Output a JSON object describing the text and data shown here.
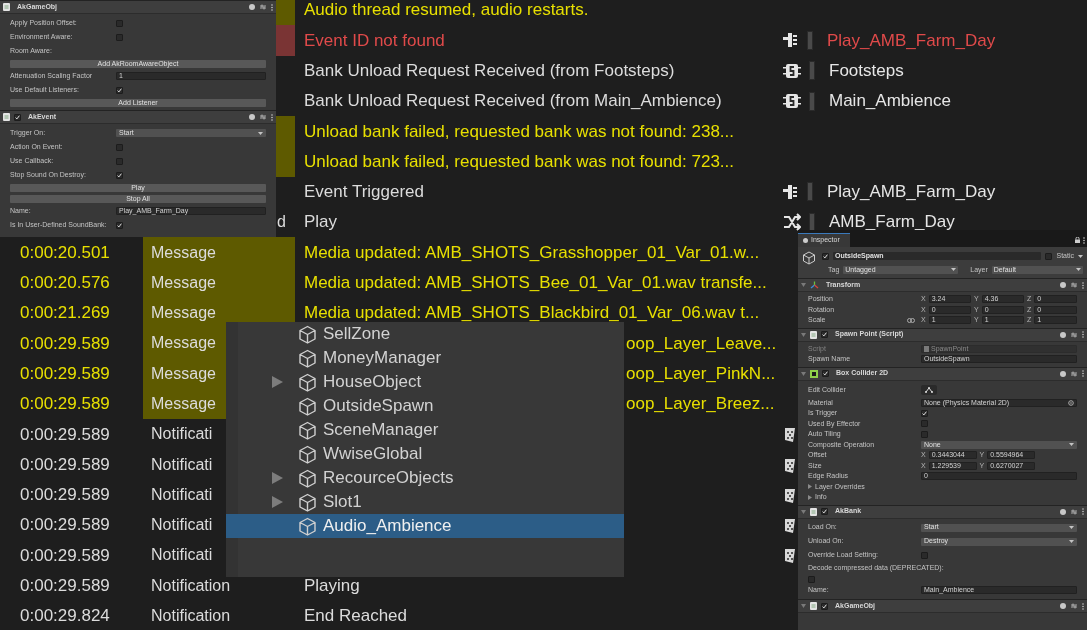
{
  "log": {
    "rows": [
      {
        "kind": "warning",
        "message": "Audio thread resumed, audio restarts."
      },
      {
        "kind": "error",
        "message": "Event ID not found",
        "object": {
          "kind": "event",
          "name": "Play_AMB_Farm_Day"
        }
      },
      {
        "kind": "info",
        "message": "Bank Unload Request Received (from Footsteps)",
        "object": {
          "kind": "bank",
          "name": "Footsteps"
        }
      },
      {
        "kind": "info",
        "message": "Bank Unload Request Received (from Main_Ambience)",
        "object": {
          "kind": "bank",
          "name": "Main_Ambience"
        }
      },
      {
        "kind": "warning",
        "message": "Unload bank failed, requested bank was not found: 238..."
      },
      {
        "kind": "warning",
        "message": "Unload bank failed, requested bank was not found: 723..."
      },
      {
        "kind": "info",
        "message": "Event Triggered",
        "object": {
          "kind": "event",
          "name": "Play_AMB_Farm_Day"
        }
      },
      {
        "kind": "info",
        "type_tail": "d",
        "message": "Play",
        "object": {
          "kind": "switch",
          "name": "AMB_Farm_Day"
        }
      },
      {
        "kind": "warning",
        "time": "0:00:20.501",
        "type": "Message",
        "message": "Media updated: AMB_SHOTS_Grasshopper_01_Var_01.w..."
      },
      {
        "kind": "warning",
        "time": "0:00:20.576",
        "type": "Message",
        "message": "Media updated: AMB_SHOTS_Bee_01_Var_01.wav transfe..."
      },
      {
        "kind": "warning",
        "time": "0:00:21.269",
        "type": "Message",
        "message": "Media updated: AMB_SHOTS_Blackbird_01_Var_06.wav t..."
      },
      {
        "kind": "warning",
        "time": "0:00:29.589",
        "type": "Message",
        "message_tail": "oop_Layer_Leave..."
      },
      {
        "kind": "warning",
        "time": "0:00:29.589",
        "type": "Message",
        "message_tail": "oop_Layer_PinkN..."
      },
      {
        "kind": "warning",
        "time": "0:00:29.589",
        "type": "Message",
        "message_tail": "oop_Layer_Breez..."
      },
      {
        "kind": "info",
        "time": "0:00:29.589",
        "type": "Notificati",
        "object": {
          "kind": "gameobject"
        }
      },
      {
        "kind": "info",
        "time": "0:00:29.589",
        "type": "Notificati",
        "object": {
          "kind": "gameobject"
        }
      },
      {
        "kind": "info",
        "time": "0:00:29.589",
        "type": "Notificati",
        "object": {
          "kind": "gameobject"
        }
      },
      {
        "kind": "info",
        "time": "0:00:29.589",
        "type": "Notificati",
        "object": {
          "kind": "gameobject"
        }
      },
      {
        "kind": "info",
        "time": "0:00:29.589",
        "type": "Notificati",
        "object": {
          "kind": "gameobject"
        }
      },
      {
        "kind": "info",
        "time": "0:00:29.589",
        "type": "Notification",
        "message": "Playing"
      },
      {
        "kind": "info",
        "time": "0:00:29.824",
        "type": "Notification",
        "message": "End Reached"
      }
    ]
  },
  "component_panel": {
    "components": [
      {
        "kind": "wwise",
        "title": "AkGameObj",
        "rows": [
          {
            "kind": "checkbox",
            "label": "Apply Position Offset:",
            "checked": false
          },
          {
            "kind": "checkbox",
            "label": "Environment Aware:",
            "checked": false
          },
          {
            "kind": "label",
            "label": "Room Aware:"
          },
          {
            "kind": "button",
            "label": "Add AkRoomAwareObject"
          },
          {
            "kind": "field",
            "label": "Attenuation Scaling Factor",
            "value": "1"
          },
          {
            "kind": "checkbox",
            "label": "Use Default Listeners:",
            "checked": true
          },
          {
            "kind": "button",
            "label": "Add Listener"
          }
        ]
      },
      {
        "kind": "wwise",
        "title": "AkEvent",
        "enabled": true,
        "rows": [
          {
            "kind": "dropdown",
            "label": "Trigger On:",
            "value": "Start"
          },
          {
            "kind": "checkbox",
            "label": "Action On Event:",
            "checked": false
          },
          {
            "kind": "checkbox",
            "label": "Use Callback:",
            "checked": false
          },
          {
            "kind": "checkbox",
            "label": "Stop Sound On Destroy:",
            "checked": true
          },
          {
            "kind": "button",
            "label": "Play"
          },
          {
            "kind": "button",
            "label": "Stop All"
          },
          {
            "kind": "field",
            "label": "Name:",
            "value": "Play_AMB_Farm_Day"
          },
          {
            "kind": "checkbox",
            "label": "Is In User-Defined SoundBank:",
            "checked": true
          }
        ]
      }
    ]
  },
  "hierarchy": {
    "items": [
      {
        "name": "SellZone",
        "has_children": false,
        "selected": false
      },
      {
        "name": "MoneyManager",
        "has_children": false,
        "selected": false
      },
      {
        "name": "HouseObject",
        "has_children": true,
        "selected": false
      },
      {
        "name": "OutsideSpawn",
        "has_children": false,
        "selected": false
      },
      {
        "name": "SceneManager",
        "has_children": false,
        "selected": false
      },
      {
        "name": "WwiseGlobal",
        "has_children": false,
        "selected": false
      },
      {
        "name": "RecourceObjects",
        "has_children": true,
        "selected": false
      },
      {
        "name": "Slot1",
        "has_children": true,
        "selected": false
      },
      {
        "name": "Audio_Ambience",
        "has_children": false,
        "selected": true
      }
    ]
  },
  "inspector": {
    "tab": "Inspector",
    "object": {
      "active": true,
      "name": "OutsideSpawn",
      "static_label": "Static",
      "static": false,
      "tag_label": "Tag",
      "tag": "Untagged",
      "layer_label": "Layer",
      "layer": "Default"
    },
    "components": [
      {
        "kind": "transform",
        "title": "Transform",
        "rows": [
          {
            "kind": "xyz",
            "label": "Position",
            "axes": [
              {
                "axis": "X",
                "value": "3.24"
              },
              {
                "axis": "Y",
                "value": "4.36"
              },
              {
                "axis": "Z",
                "value": "0"
              }
            ]
          },
          {
            "kind": "xyz",
            "label": "Rotation",
            "axes": [
              {
                "axis": "X",
                "value": "0"
              },
              {
                "axis": "Y",
                "value": "0"
              },
              {
                "axis": "Z",
                "value": "0"
              }
            ]
          },
          {
            "kind": "scale",
            "label": "Scale",
            "axes": [
              {
                "axis": "X",
                "value": "1"
              },
              {
                "axis": "Y",
                "value": "1"
              },
              {
                "axis": "Z",
                "value": "1"
              }
            ]
          }
        ]
      },
      {
        "kind": "script",
        "title": "Spawn Point (Script)",
        "enabled": true,
        "rows": [
          {
            "kind": "script_field",
            "label": "Script",
            "value": "SpawnPoint"
          },
          {
            "kind": "field",
            "label": "Spawn Name",
            "value": "OutsideSpawn"
          }
        ]
      },
      {
        "kind": "collider",
        "title": "Box Collider 2D",
        "enabled": true,
        "rows": [
          {
            "kind": "icon_button",
            "label": "Edit Collider"
          },
          {
            "kind": "object_field",
            "label": "Material",
            "value": "None (Physics Material 2D)"
          },
          {
            "kind": "checkbox",
            "label": "Is Trigger",
            "checked": true
          },
          {
            "kind": "checkbox",
            "label": "Used By Effector",
            "checked": false
          },
          {
            "kind": "checkbox",
            "label": "Auto Tiling",
            "checked": false
          },
          {
            "kind": "dropdown",
            "label": "Composite Operation",
            "value": "None"
          },
          {
            "kind": "xy",
            "label": "Offset",
            "axes": [
              {
                "axis": "X",
                "value": "0.3443044"
              },
              {
                "axis": "Y",
                "value": "0.5594964"
              }
            ]
          },
          {
            "kind": "xy",
            "label": "Size",
            "axes": [
              {
                "axis": "X",
                "value": "1.229539"
              },
              {
                "axis": "Y",
                "value": "0.6270027"
              }
            ]
          },
          {
            "kind": "field",
            "label": "Edge Radius",
            "value": "0"
          },
          {
            "kind": "foldout",
            "label": "Layer Overrides"
          },
          {
            "kind": "foldout",
            "label": "Info"
          }
        ]
      },
      {
        "kind": "wwise",
        "title": "AkBank",
        "enabled": true,
        "rows": [
          {
            "kind": "dropdown",
            "label": "Load On:",
            "value": "Start"
          },
          {
            "kind": "dropdown",
            "label": "Unload On:",
            "value": "Destroy"
          },
          {
            "kind": "checkbox",
            "label": "Override Load Setting:",
            "checked": false
          },
          {
            "kind": "checkbox_below",
            "label": "Decode compressed data (DEPRECATED):",
            "checked": false
          },
          {
            "kind": "field",
            "label": "Name:",
            "value": "Main_Ambience"
          }
        ]
      },
      {
        "kind": "wwise",
        "title": "AkGameObj",
        "enabled": true
      }
    ]
  }
}
